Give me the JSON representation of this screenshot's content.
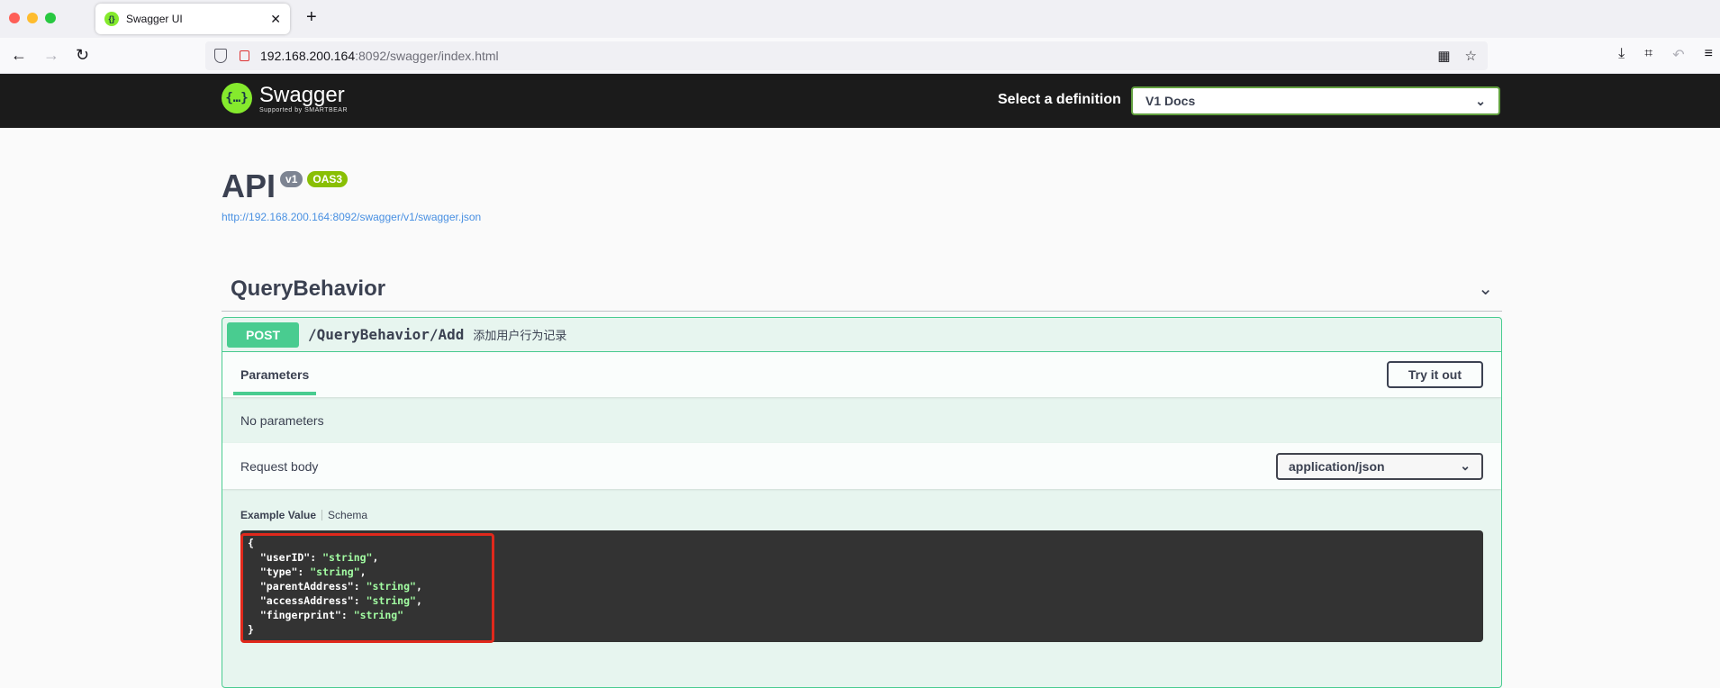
{
  "browser": {
    "tab_title": "Swagger UI",
    "url_host": "192.168.200.164",
    "url_rest": ":8092/swagger/index.html"
  },
  "swagger": {
    "logo_title": "Swagger",
    "logo_sub": "Supported by SMARTBEAR",
    "definition_label": "Select a definition",
    "definition_value": "V1 Docs"
  },
  "info": {
    "title": "API",
    "version_badge": "v1",
    "oas_badge": "OAS3",
    "spec_url": "http://192.168.200.164:8092/swagger/v1/swagger.json"
  },
  "tag": {
    "name": "QueryBehavior"
  },
  "operation": {
    "method": "POST",
    "path": "/QueryBehavior/Add",
    "description": "添加用户行为记录",
    "parameters_tab": "Parameters",
    "try_button": "Try it out",
    "no_parameters": "No parameters",
    "request_body_label": "Request body",
    "content_type": "application/json",
    "example_tab": "Example Value",
    "schema_tab": "Schema",
    "example_fields": [
      {
        "key": "userID",
        "value": "string"
      },
      {
        "key": "type",
        "value": "string"
      },
      {
        "key": "parentAddress",
        "value": "string"
      },
      {
        "key": "accessAddress",
        "value": "string"
      },
      {
        "key": "fingerprint",
        "value": "string"
      }
    ]
  },
  "colors": {
    "post_accent": "#49cc90",
    "topbar_bg": "#1b1b1b",
    "highlight_border": "#e0291c"
  }
}
